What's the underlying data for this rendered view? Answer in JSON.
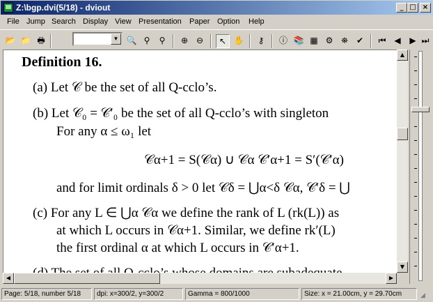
{
  "window": {
    "title": "Z:\\bgp.dvi(5/18) - dviout",
    "minimize": "_",
    "maximize": "□",
    "close": "×"
  },
  "menu": [
    "File",
    "Jump",
    "Search",
    "Display",
    "View",
    "Presentation",
    "Paper",
    "Option",
    "Help"
  ],
  "toolbar": {
    "page_value": "",
    "icons": [
      "open-folder-icon",
      "open-file-icon",
      "print-icon",
      "search-file-icon",
      "find-icon",
      "find-next-icon",
      "zoom-in-icon",
      "zoom-out-icon",
      "select-arrow-icon",
      "hand-icon",
      "magnifier-icon",
      "info-icon",
      "bookmark-icon",
      "setup-icon",
      "settings-icon",
      "stamp-icon",
      "check-icon",
      "first-page-icon",
      "prev-page-icon",
      "next-page-icon",
      "last-page-icon"
    ],
    "glyphs": [
      "📂",
      "📁",
      "🖶",
      "🔍",
      "⚲",
      "⚲",
      "⊕",
      "⊖",
      "↖",
      "✋",
      "⚷",
      "ⓘ",
      "📚",
      "▦",
      "⚙",
      "⛯",
      "✔",
      "⏮",
      "◀",
      "▶",
      "⏭"
    ]
  },
  "document": {
    "heading": "Definition 16.",
    "lines": [
      "(a)  Let 𝒞 be the set of all Q-cclo’s.",
      "(b)  Let 𝒞₀ = 𝒞′₀ be the set of all Q-cclo’s with singleton",
      "For any α ≤ ω₁ let",
      "𝒞α+1 = S(𝒞α) ∪ 𝒞α        𝒞′α+1 = S′(𝒞′α)",
      "and for limit ordinals δ > 0 let 𝒞δ = ⋃α<δ 𝒞α, 𝒞′δ = ⋃",
      "(c)  For any L ∈ ⋃α 𝒞α we define the rank of L (rk(L)) as",
      "at which L occurs in 𝒞α+1. Similar, we define rk′(L)",
      "the first ordinal α at which L occurs in 𝒞′α+1.",
      "(d)  The set of all Q-cclo’s whose domains are subadequate"
    ]
  },
  "status": {
    "page": "Page: 5/18, number 5/18",
    "dpi": "dpi: x=300/2, y=300/2",
    "gamma": "Gamma = 800/1000",
    "size": "Size: x = 21.00cm, y = 29.70cm"
  }
}
